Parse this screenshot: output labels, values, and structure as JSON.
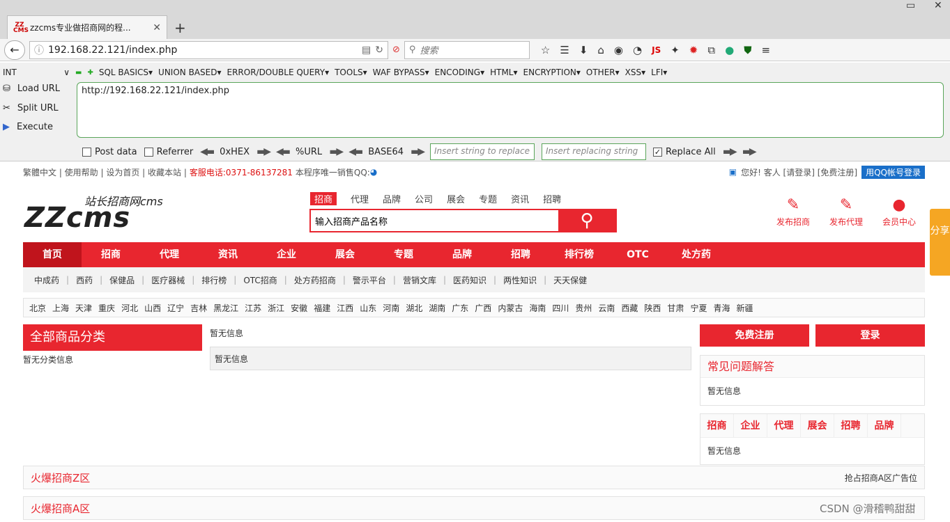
{
  "browser": {
    "tab_title": "zzcms专业做招商网的程...",
    "tab_favicon": "ZZ CMS",
    "url": "192.168.22.121/index.php",
    "search_placeholder": "搜索",
    "js_label": "JS"
  },
  "hackbar": {
    "selected_type": "INT",
    "menu": [
      "SQL BASICS▾",
      "UNION BASED▾",
      "ERROR/DOUBLE QUERY▾",
      "TOOLS▾",
      "WAF BYPASS▾",
      "ENCODING▾",
      "HTML▾",
      "ENCRYPTION▾",
      "OTHER▾",
      "XSS▾",
      "LFI▾"
    ],
    "load_url": "Load URL",
    "split_url": "Split URL",
    "execute": "Execute",
    "url_value": "http://192.168.22.121/index.php",
    "post_data": "Post data",
    "referrer": "Referrer",
    "hex": "0xHEX",
    "url_enc": "%URL",
    "base64": "BASE64",
    "replace_placeholder": "Insert string to replace",
    "replacing_placeholder": "Insert replacing string",
    "replace_all": "Replace All"
  },
  "site": {
    "topbar_links": "繁體中文 | 使用帮助 | 设为首页 | 收藏本站 |",
    "phone": "客服电话:0371-86137281",
    "sales_qq": "本程序唯一销售QQ:",
    "greeting": "您好! 客人 [请登录] [免费注册]",
    "qq_login": "用QQ帐号登录",
    "logo_big": "ZZcms",
    "logo_small": "站长招商网cms",
    "search_tabs": [
      "招商",
      "代理",
      "品牌",
      "公司",
      "展会",
      "专题",
      "资讯",
      "招聘"
    ],
    "search_input": "输入招商产品名称",
    "quick": [
      {
        "label": "发布招商"
      },
      {
        "label": "发布代理"
      },
      {
        "label": "会员中心"
      }
    ],
    "share": "分享",
    "mainnav": [
      "首页",
      "招商",
      "代理",
      "资讯",
      "企业",
      "展会",
      "专题",
      "品牌",
      "招聘",
      "排行榜",
      "OTC",
      "处方药"
    ],
    "subnav": [
      "中成药",
      "西药",
      "保健品",
      "医疗器械",
      "排行榜",
      "OTC招商",
      "处方药招商",
      "警示平台",
      "营销文库",
      "医药知识",
      "两性知识",
      "天天保健"
    ],
    "regions": [
      "北京",
      "上海",
      "天津",
      "重庆",
      "河北",
      "山西",
      "辽宁",
      "吉林",
      "黑龙江",
      "江苏",
      "浙江",
      "安徽",
      "福建",
      "江西",
      "山东",
      "河南",
      "湖北",
      "湖南",
      "广东",
      "广西",
      "内蒙古",
      "海南",
      "四川",
      "贵州",
      "云南",
      "西藏",
      "陕西",
      "甘肃",
      "宁夏",
      "青海",
      "新疆"
    ],
    "cat_title": "全部商品分类",
    "cat_empty": "暂无分类信息",
    "no_info": "暂无信息",
    "register": "免费注册",
    "login": "登录",
    "faq_title": "常见问题解答",
    "tabs2": [
      "招商",
      "企业",
      "代理",
      "展会",
      "招聘",
      "品牌"
    ],
    "hot_z": "火爆招商Z区",
    "hot_z_ad": "抢占招商A区广告位",
    "hot_a": "火爆招商A区",
    "watermark": "CSDN @滑稽鸭甜甜"
  },
  "colors": {
    "accent": "#e8262f",
    "accent_dark": "#c0141c",
    "share": "#f5a623"
  }
}
